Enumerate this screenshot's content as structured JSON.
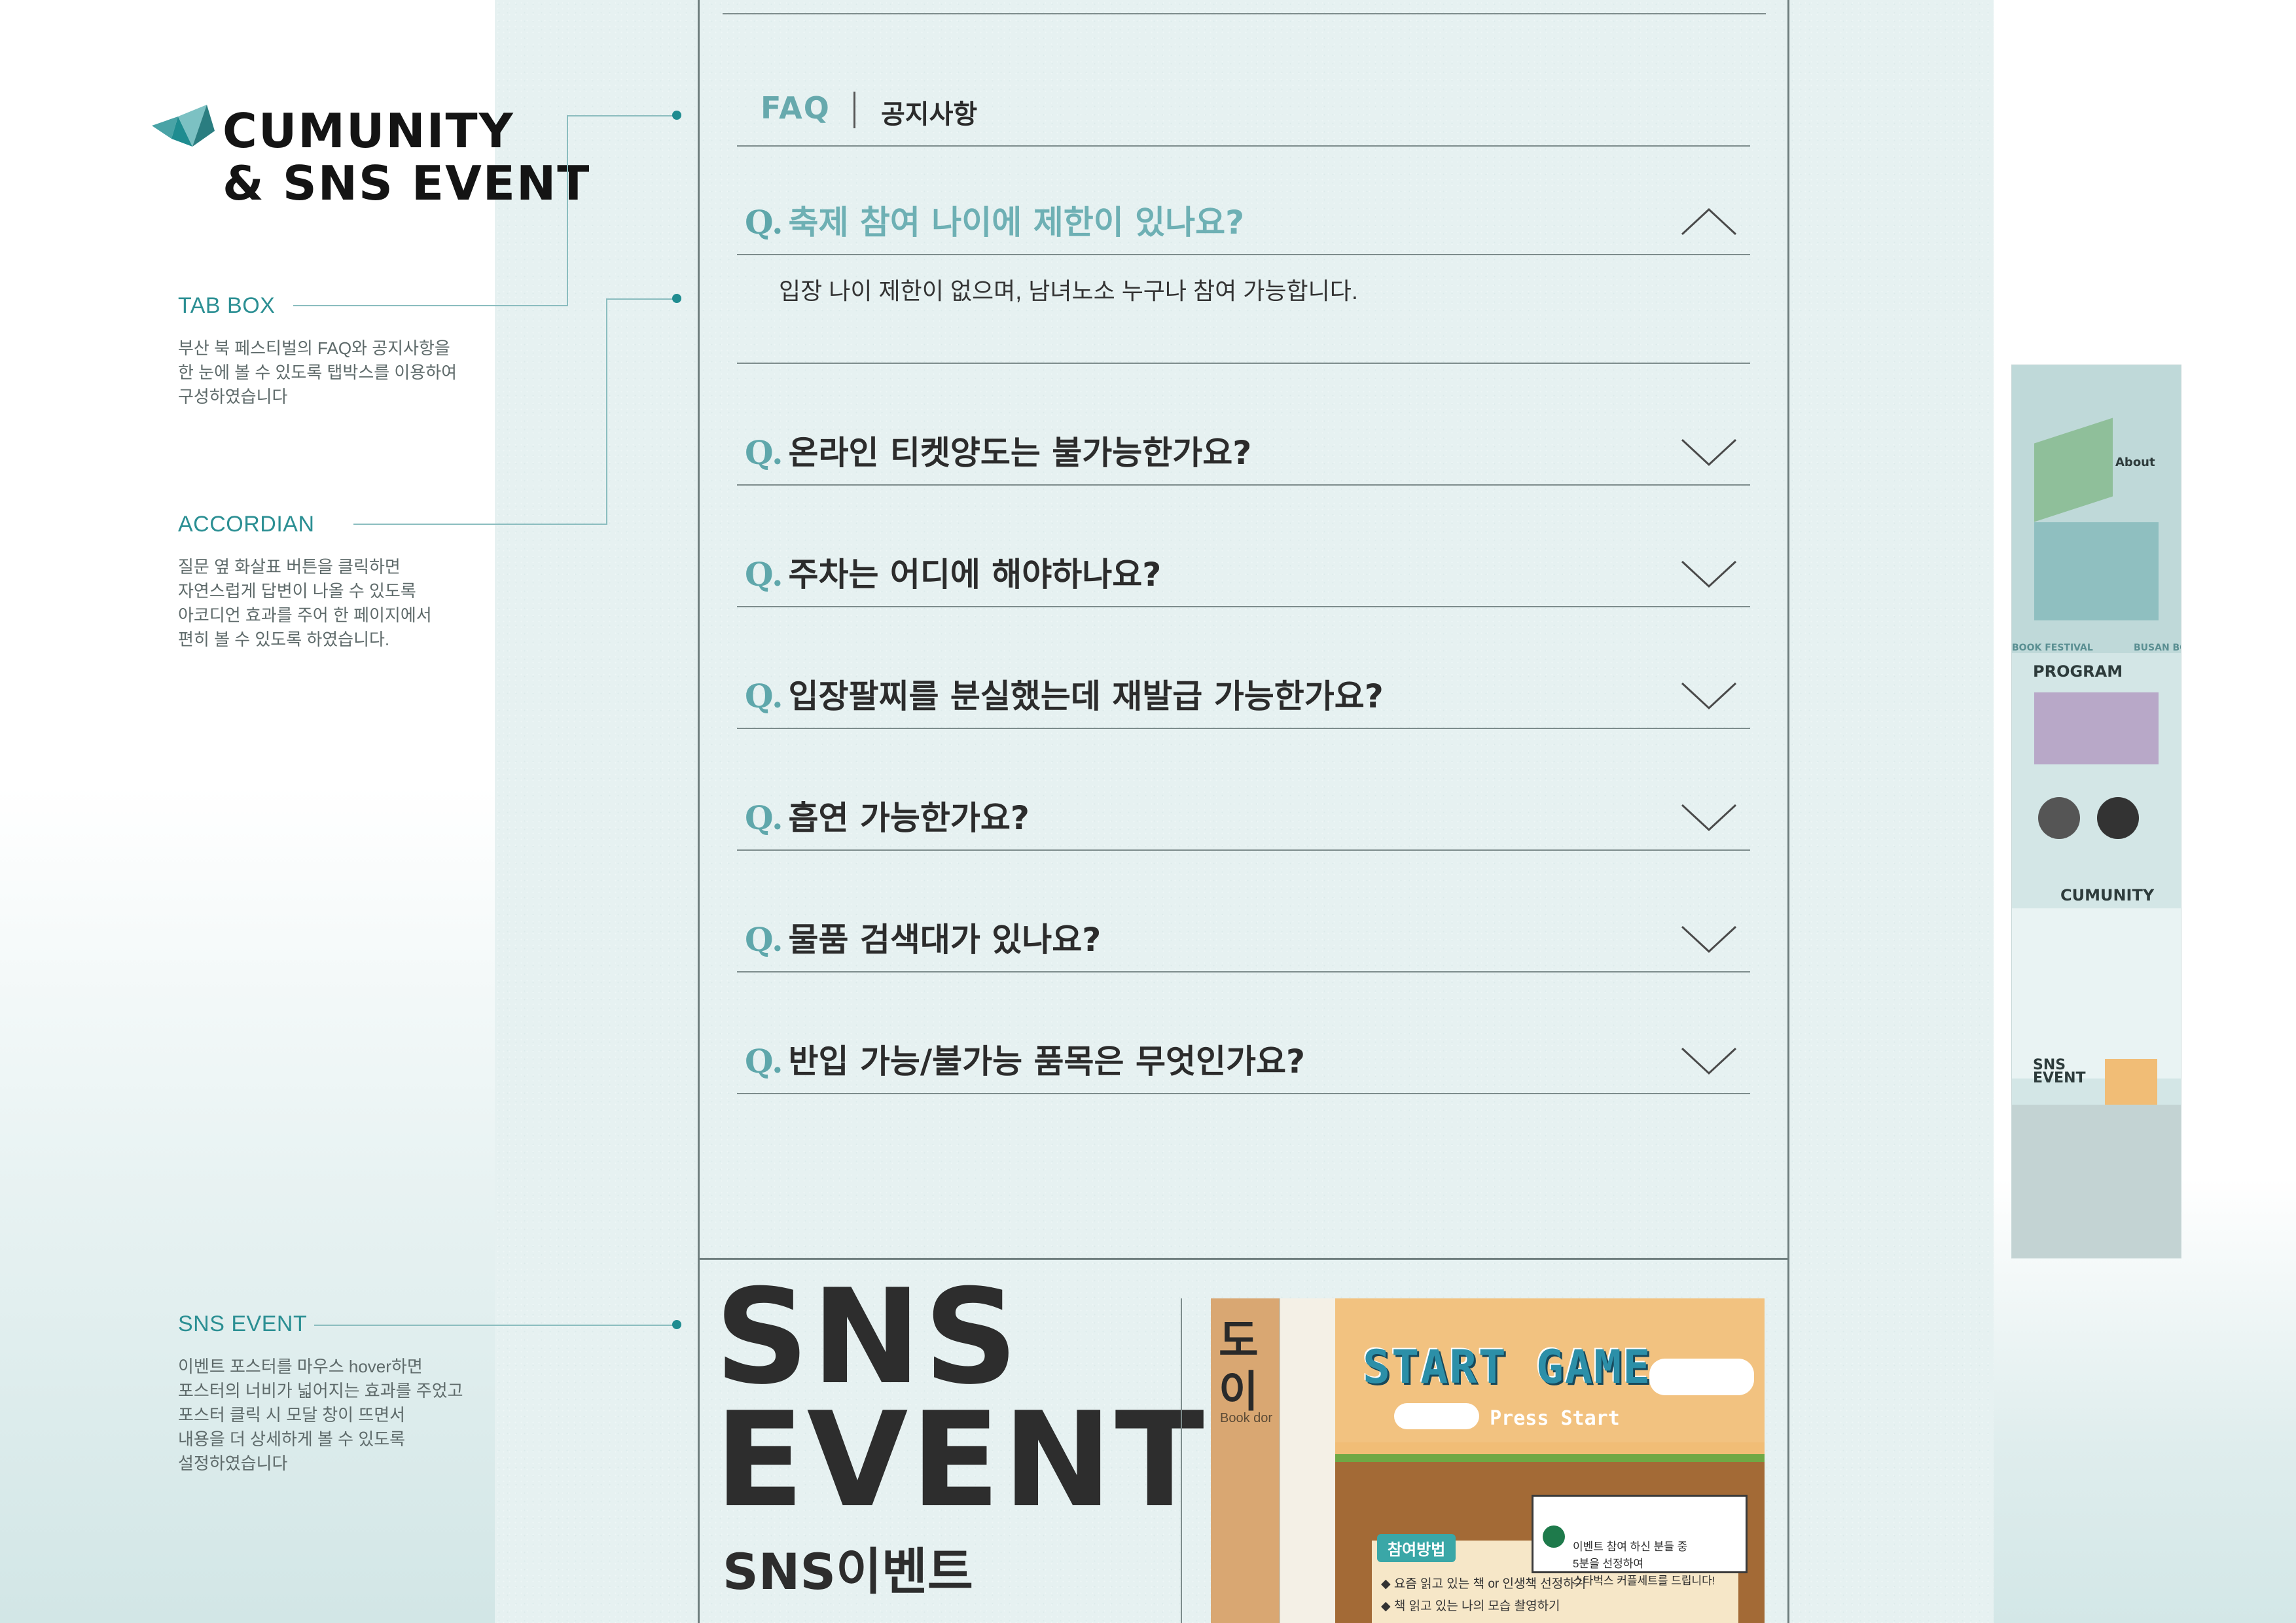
{
  "brand": {
    "title_line1": "CUMUNITY",
    "title_line2": "& SNS EVENT",
    "accent_color": "#1f8c90"
  },
  "notes": {
    "tabbox": {
      "title": "TAB BOX",
      "body": [
        "부산 북 페스티벌의 FAQ와 공지사항을",
        "한 눈에 볼 수 있도록 탭박스를 이용하여",
        "구성하였습니다"
      ]
    },
    "accordian": {
      "title": "ACCORDIAN",
      "body": [
        "질문 옆 화살표 버튼을 클릭하면",
        "자연스럽게 답변이 나올 수 있도록",
        "아코디언 효과를 주어 한 페이지에서",
        "편히 볼 수 있도록 하였습니다."
      ]
    },
    "sns": {
      "title": "SNS EVENT",
      "body": [
        "이벤트 포스터를 마우스 hover하면",
        "포스터의 너비가 넓어지는 효과를 주었고",
        "포스터 클릭 시 모달 창이 뜨면서",
        "내용을 더 상세하게 볼 수 있도록",
        "설정하였습니다"
      ]
    }
  },
  "tabs": {
    "faq": "FAQ",
    "notice": "공지사항",
    "active": "FAQ"
  },
  "faq": {
    "q_prefix": "Q.",
    "items": [
      {
        "question": "축제 참여 나이에 제한이 있나요?",
        "answer": "입장 나이 제한이 없으며, 남녀노소 누구나 참여 가능합니다.",
        "open": true
      },
      {
        "question": "온라인 티켓양도는 불가능한가요?",
        "open": false
      },
      {
        "question": "주차는 어디에 해야하나요?",
        "open": false
      },
      {
        "question": "입장팔찌를 분실했는데 재발급 가능한가요?",
        "open": false
      },
      {
        "question": "흡연 가능한가요?",
        "open": false
      },
      {
        "question": "물품 검색대가 있나요?",
        "open": false
      },
      {
        "question": "반입 가능/불가능 품목은 무엇인가요?",
        "open": false
      }
    ]
  },
  "sns_event": {
    "title_line1": "SNS",
    "title_line2": "EVENT",
    "subtitle": "SNS이벤트",
    "poster_back": {
      "title": "도\n이",
      "caption": "Book dor"
    },
    "poster_front": {
      "title": "START GAME",
      "press": "▶ Press Start",
      "card_text": "이벤트 참여 하신 분들 중\n5분을 선정하여\n스타벅스 커플세트를 드립니다!",
      "method_label": "참여방법",
      "steps": "◆ 요즘 읽고 있는 책 or 인생책 선정하기\n◆ 책 읽고 있는 나의 모습 촬영하기"
    }
  },
  "thumbnail": {
    "about": "About",
    "program": "PROGRAM",
    "cumunity": "CUMUNITY",
    "sns": "SNS\nEVENT",
    "festival": "BOOK FESTIVAL",
    "busan": "BUSAN BO"
  }
}
